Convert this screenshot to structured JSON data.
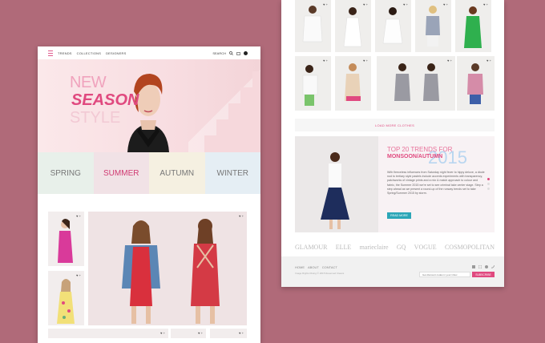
{
  "nav": {
    "links": [
      "TRENDS",
      "COLLECTIONS",
      "DESIGNERS"
    ],
    "search_label": "SEARCH"
  },
  "hero": {
    "line1": "NEW",
    "line2": "SEASON",
    "line3": "STYLE"
  },
  "seasons": [
    {
      "label": "SPRING",
      "bg": "#e8f0ea",
      "color": "#777777"
    },
    {
      "label": "SUMMER",
      "bg": "#f1e2e6",
      "color": "#d03a72"
    },
    {
      "label": "AUTUMN",
      "bg": "#f5f0e1",
      "color": "#777777"
    },
    {
      "label": "WINTER",
      "bg": "#e5eef4",
      "color": "#777777"
    }
  ],
  "product_icons": "♥ +",
  "load_more": "LOAD MORE CLOTHES",
  "promo": {
    "title1": "TOP 20 TRENDS FOR",
    "title2": "MONSOON/AUTUMN",
    "year": "2015",
    "body": "With fleeceless influences from Saturday night fever to hippy deluxe, a diode nod to tertiary style pastels include accents experiments with transparency, patchworks of vintage prints and a mix & match approach to colour and fabric, the Summer 2015 we're set to see criminal take center stage. Step a step ahead as we present a round-up of the runway trends set to take Spring/Summer 2015 by storm.",
    "button": "READ MORE"
  },
  "brand_logos": [
    "GLAMOUR",
    "ELLE",
    "marieclaire",
    "GQ",
    "VOGUE",
    "COSMOPOLITAN"
  ],
  "footer": {
    "links": [
      "HOME",
      "ABOUT",
      "CONTACT"
    ],
    "copyright": "Image Rights Rising © 2015 Reserved Cleans",
    "newsletter_placeholder": "Get discount codes in your inbox",
    "subscribe": "SUBSCRIBE",
    "social_icons": [
      "facebook-icon",
      "instagram-icon",
      "pinterest-icon",
      "twitter-icon"
    ]
  },
  "colors": {
    "accent": "#e0497f",
    "button": "#2ba6b7",
    "background": "#b06a79"
  }
}
